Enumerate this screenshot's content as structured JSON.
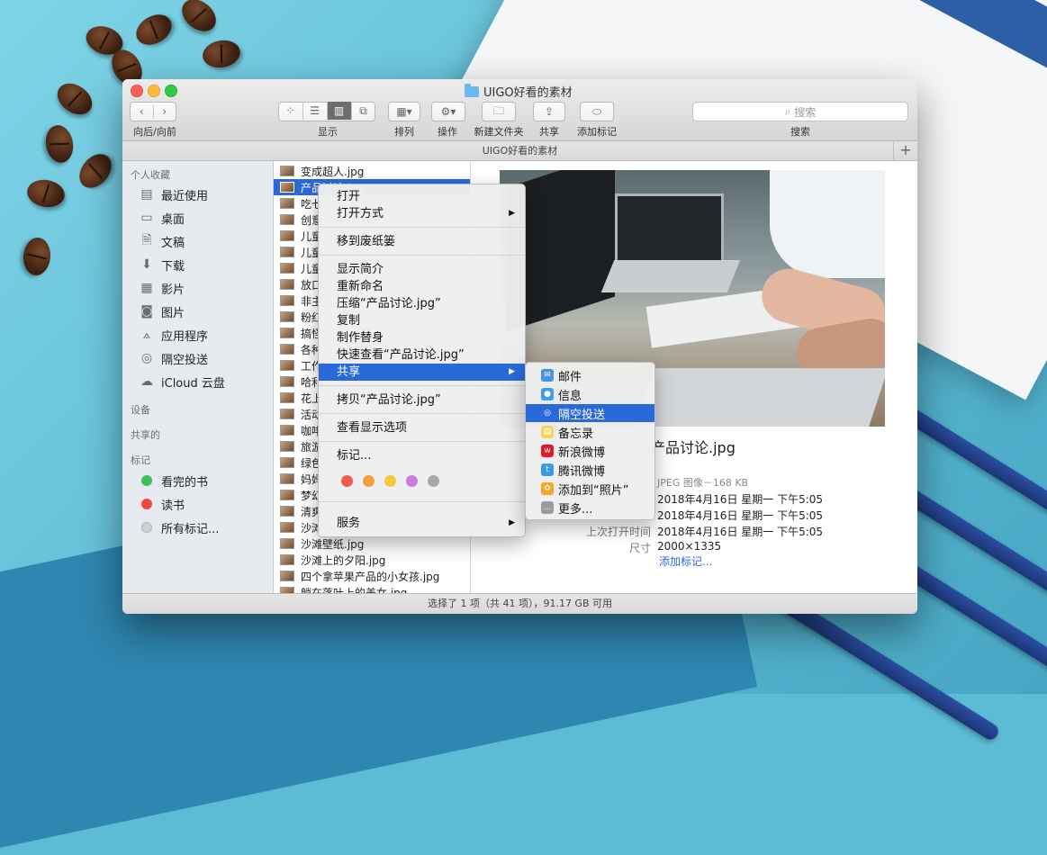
{
  "window": {
    "title": "UIGO好看的素材"
  },
  "toolbar": {
    "nav_label": "向后/向前",
    "view_label": "显示",
    "arrange_label": "排列",
    "action_label": "操作",
    "new_folder_label": "新建文件夹",
    "share_label": "共享",
    "add_tag_label": "添加标记",
    "search_placeholder": "搜索",
    "search_label": "搜索"
  },
  "pathbar": {
    "title": "UIGO好看的素材"
  },
  "sidebar": {
    "favorites_header": "个人收藏",
    "favorites": [
      {
        "label": "最近使用",
        "icon": "recents-icon"
      },
      {
        "label": "桌面",
        "icon": "desktop-icon"
      },
      {
        "label": "文稿",
        "icon": "documents-icon"
      },
      {
        "label": "下载",
        "icon": "downloads-icon"
      },
      {
        "label": "影片",
        "icon": "movies-icon"
      },
      {
        "label": "图片",
        "icon": "pictures-icon"
      },
      {
        "label": "应用程序",
        "icon": "applications-icon"
      },
      {
        "label": "隔空投送",
        "icon": "airdrop-icon"
      },
      {
        "label": "iCloud 云盘",
        "icon": "icloud-icon"
      }
    ],
    "devices_header": "设备",
    "shared_header": "共享的",
    "tags_header": "标记",
    "tags": [
      {
        "label": "看完的书",
        "color": "#3fbf55"
      },
      {
        "label": "读书",
        "color": "#f2473f"
      },
      {
        "label": "所有标记...",
        "color": "#d0d0d0"
      }
    ]
  },
  "files": [
    "变成超人.jpg",
    "产品讨论.jpg",
    "吃七",
    "创意",
    "儿童",
    "儿童",
    "儿童",
    "放口",
    "非主",
    "粉红",
    "搞怪",
    "各种",
    "工作",
    "哈利",
    "花上",
    "活动",
    "咖啡",
    "旅游",
    "绿色",
    "妈妈",
    "梦幻",
    "清爽",
    "沙滩",
    "沙滩壁纸.jpg",
    "沙滩上的夕阳.jpg",
    "四个拿苹果产品的小女孩.jpg",
    "躺在落叶上的美女.jpg"
  ],
  "preview": {
    "filename": "产品讨论.jpg",
    "type": "JPEG 图像－168 KB",
    "created": "2018年4月16日 星期一 下午5:05",
    "modified": "2018年4月16日 星期一 下午5:05",
    "last_opened_label": "上次打开时间",
    "last_opened": "2018年4月16日 星期一 下午5:05",
    "size_label": "尺寸",
    "size": "2000×1335",
    "add_tags": "添加标记..."
  },
  "status": {
    "text": "选择了 1 项（共 41 项），91.17 GB 可用"
  },
  "context_menu": {
    "open": "打开",
    "open_with": "打开方式",
    "trash": "移到废纸篓",
    "get_info": "显示简介",
    "rename": "重新命名",
    "compress": "压缩“产品讨论.jpg”",
    "duplicate": "复制",
    "make_alias": "制作替身",
    "quick_look": "快速查看“产品讨论.jpg”",
    "share": "共享",
    "copy": "拷贝“产品讨论.jpg”",
    "view_options": "查看显示选项",
    "tags": "标记...",
    "tag_colors": [
      "#f05a50",
      "#f2a03d",
      "#f5c93e",
      "#c67fdc",
      "#a8a8a8"
    ],
    "services": "服务"
  },
  "share_submenu": [
    {
      "label": "邮件",
      "icon": "mail-icon",
      "color": "#4a90e2"
    },
    {
      "label": "信息",
      "icon": "messages-icon",
      "color": "#3d9df0"
    },
    {
      "label": "隔空投送",
      "icon": "airdrop-icon",
      "color": "#2a6ad8"
    },
    {
      "label": "备忘录",
      "icon": "notes-icon",
      "color": "#f3d35a"
    },
    {
      "label": "新浪微博",
      "icon": "weibo-icon",
      "color": "#e6162d"
    },
    {
      "label": "腾讯微博",
      "icon": "tencent-weibo-icon",
      "color": "#3b9ae1"
    },
    {
      "label": "添加到“照片”",
      "icon": "photos-icon",
      "color": "#f5a623"
    },
    {
      "label": "更多...",
      "icon": "more-icon",
      "color": "#9b9b9b"
    }
  ]
}
